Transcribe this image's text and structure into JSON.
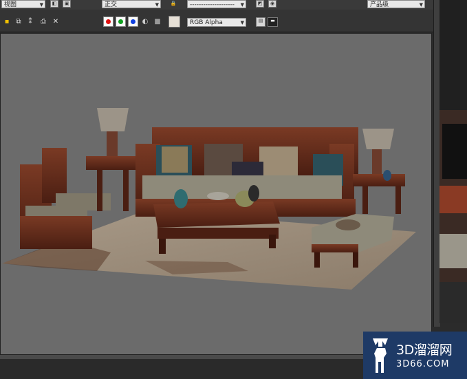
{
  "top_toolbar": {
    "view_dropdown": "视图",
    "projection_dropdown": "正交",
    "layer_dropdown": "--------------------",
    "render_level_dropdown": "产品级"
  },
  "frame_toolbar": {
    "channel_dropdown": "RGB Alpha",
    "red_channel_color": "#e01010",
    "green_channel_color": "#10a020",
    "blue_channel_color": "#1040e0",
    "background_swatch_color": "#e6e0d6",
    "icons": [
      "save-icon",
      "copy-icon",
      "clone-icon",
      "print-icon",
      "clear-icon",
      "mono-icon",
      "display-icon",
      "fullscreen-icon"
    ]
  },
  "watermark": {
    "title": "3D溜溜网",
    "subtitle": "3D66.COM"
  }
}
